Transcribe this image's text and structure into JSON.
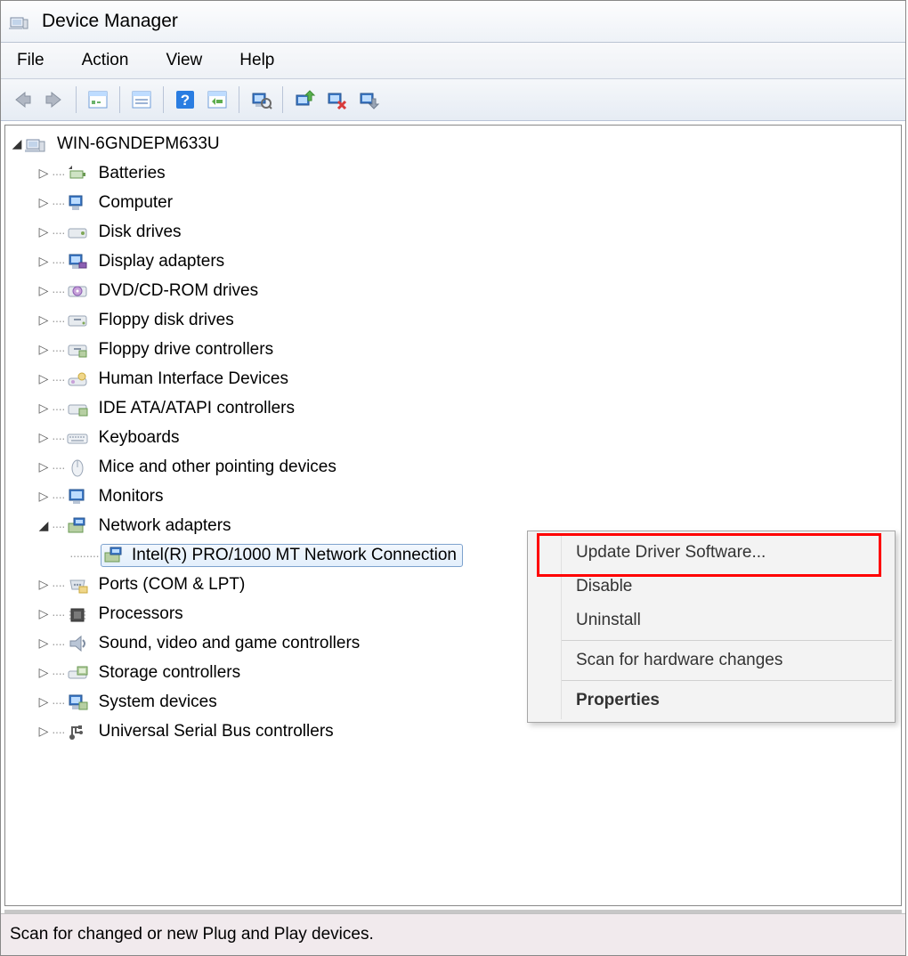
{
  "window": {
    "title": "Device Manager"
  },
  "menu": {
    "file": "File",
    "action": "Action",
    "view": "View",
    "help": "Help"
  },
  "tree": {
    "root": "WIN-6GNDEPM633U",
    "items": [
      "Batteries",
      "Computer",
      "Disk drives",
      "Display adapters",
      "DVD/CD-ROM drives",
      "Floppy disk drives",
      "Floppy drive controllers",
      "Human Interface Devices",
      "IDE ATA/ATAPI controllers",
      "Keyboards",
      "Mice and other pointing devices",
      "Monitors",
      "Network adapters",
      "Ports (COM & LPT)",
      "Processors",
      "Sound, video and game controllers",
      "Storage controllers",
      "System devices",
      "Universal Serial Bus controllers"
    ],
    "network_child": "Intel(R) PRO/1000 MT Network Connection"
  },
  "context_menu": {
    "update": "Update Driver Software...",
    "disable": "Disable",
    "uninstall": "Uninstall",
    "scan": "Scan for hardware changes",
    "properties": "Properties"
  },
  "status": "Scan for changed or new Plug and Play devices."
}
